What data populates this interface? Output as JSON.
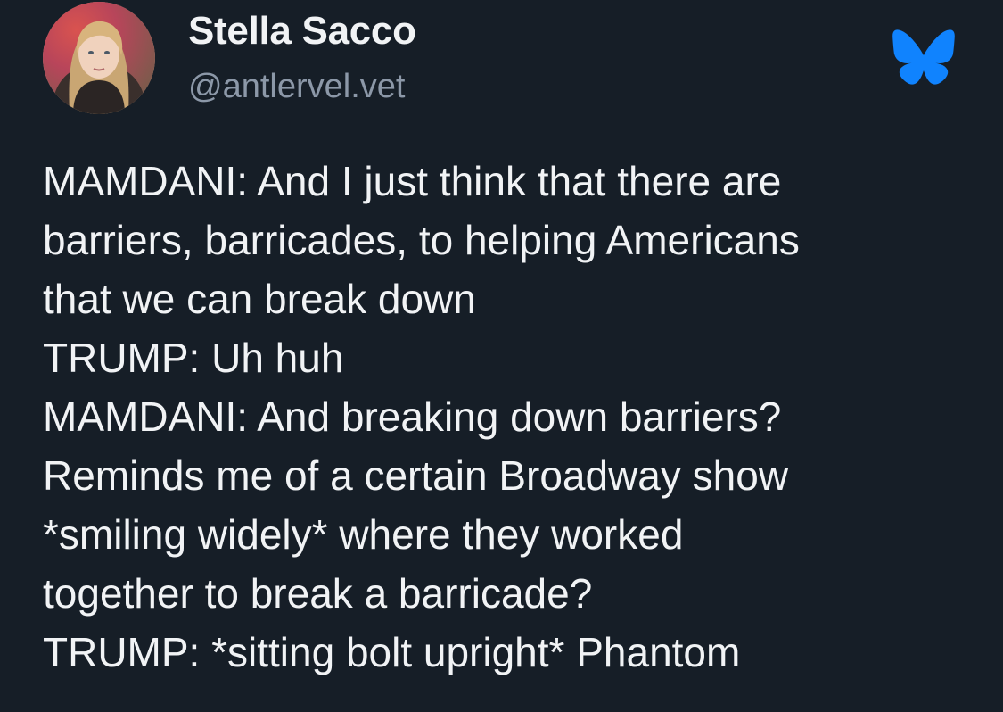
{
  "post": {
    "author": {
      "display_name": "Stella Sacco",
      "handle": "@antlervel.vet",
      "avatar": "profile-photo"
    },
    "platform_icon": "bluesky-butterfly-icon",
    "text_lines": [
      "MAMDANI: And I just think that there are",
      "barriers, barricades, to helping Americans",
      "that we can break down",
      "TRUMP: Uh huh",
      "MAMDANI: And breaking down barriers?",
      "Reminds me of a certain Broadway show",
      "*smiling widely* where they worked",
      "together to break a barricade?",
      "TRUMP: *sitting bolt upright* Phantom"
    ]
  },
  "colors": {
    "background": "#161e27",
    "text": "#f1f3f5",
    "handle": "#8c98a8",
    "bluesky_blue": "#1083fe"
  }
}
